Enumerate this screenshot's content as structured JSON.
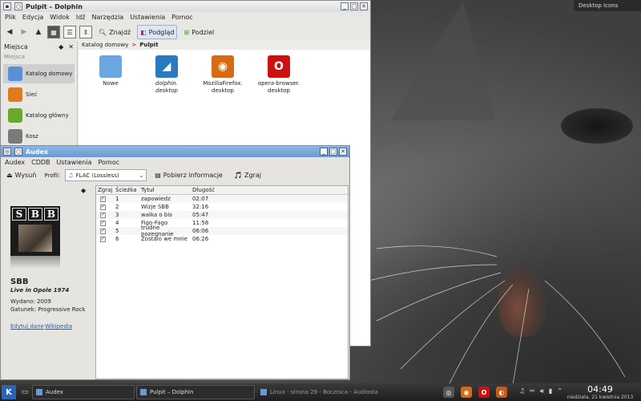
{
  "desktop": {
    "widget_label": "Desktop Icons"
  },
  "dolphin": {
    "title": "Pulpit – Dolphin",
    "menu": [
      "Plik",
      "Edycja",
      "Widok",
      "Idź",
      "Narzędzia",
      "Ustawienia",
      "Pomoc"
    ],
    "toolbar": {
      "find_label": "Znajdź",
      "preview_label": "Podgląd",
      "split_label": "Podziel"
    },
    "places": {
      "header": "Miejsca",
      "subheader": "Miejsca",
      "items": [
        {
          "label": "Katalog domowy",
          "icon": "home-folder-icon",
          "color": "#5a8fd8"
        },
        {
          "label": "Sieć",
          "icon": "network-icon",
          "color": "#e07a1f"
        },
        {
          "label": "Katalog główny",
          "icon": "root-folder-icon",
          "color": "#6aaa2a"
        },
        {
          "label": "Kosz",
          "icon": "trash-icon",
          "color": "#7a7a7a"
        }
      ]
    },
    "breadcrumb": {
      "parent": "Katalog domowy",
      "separator": ">",
      "current": "Pulpit"
    },
    "files": [
      {
        "name": "Nowe",
        "italic": false,
        "icon": "folder-icon",
        "color": "#6aa6e0",
        "glyph": ""
      },
      {
        "name": "dolphin.\ndesktop",
        "italic": true,
        "icon": "dolphin-app-icon",
        "color": "#2a7ac0",
        "glyph": "◢"
      },
      {
        "name": "MozillaFirefox.\ndesktop",
        "italic": false,
        "icon": "firefox-app-icon",
        "color": "#d86a10",
        "glyph": "◉"
      },
      {
        "name": "opera-browser.\ndesktop",
        "italic": false,
        "icon": "opera-app-icon",
        "color": "#cc1010",
        "glyph": "O"
      }
    ]
  },
  "audex": {
    "title": "Audex",
    "menu": [
      "Audex",
      "CDDB",
      "Ustawienia",
      "Pomoc"
    ],
    "toolbar": {
      "eject_label": "Wysuń",
      "profile_label": "Profil:",
      "profile_value": "FLAC (Lossless)",
      "fetch_label": "Pobierz informacje",
      "rip_label": "Zgraj"
    },
    "album": {
      "cover_logo": [
        "S",
        "B",
        "B"
      ],
      "artist": "SBB",
      "title": "Live in Opole 1974",
      "year_line": "Wydano: 2009",
      "genre_line": "Gatunek: Progressive Rock",
      "edit_link": "Edytuj dane",
      "wiki_link": "Wikipedia"
    },
    "columns": [
      "Zgraj",
      "Ścieżka",
      "Tytuł",
      "Długość"
    ],
    "tracks": [
      {
        "checked": true,
        "num": "1",
        "title": "zapowiedz",
        "length": "02:07"
      },
      {
        "checked": true,
        "num": "2",
        "title": "Wizje SBB",
        "length": "32:16"
      },
      {
        "checked": true,
        "num": "3",
        "title": "walka o bis",
        "length": "05:47"
      },
      {
        "checked": true,
        "num": "4",
        "title": "Figo-Fago",
        "length": "11:58"
      },
      {
        "checked": true,
        "num": "5",
        "title": "trudne pozegnanie",
        "length": "06:06"
      },
      {
        "checked": true,
        "num": "6",
        "title": "Zostalo we mnie",
        "length": "06:26"
      }
    ]
  },
  "taskbar": {
    "tasks": [
      {
        "label": "Audex",
        "dim": false
      },
      {
        "label": "Pulpit – Dolphin",
        "dim": false
      },
      {
        "label": "Linux - strona 29 - Bocznica - Audiosta",
        "dim": true
      }
    ],
    "tray": [
      {
        "icon": "audex-tray-icon",
        "color": "#555555",
        "glyph": "◎"
      },
      {
        "icon": "firefox-tray-icon",
        "color": "#d86a10",
        "glyph": "◉"
      },
      {
        "icon": "opera-tray-icon",
        "color": "#cc1010",
        "glyph": "O"
      },
      {
        "icon": "browser-tray-icon",
        "color": "#c85a1a",
        "glyph": "◐"
      }
    ],
    "time": "04:49",
    "date": "niedziela, 21 kwietnia 2013"
  }
}
